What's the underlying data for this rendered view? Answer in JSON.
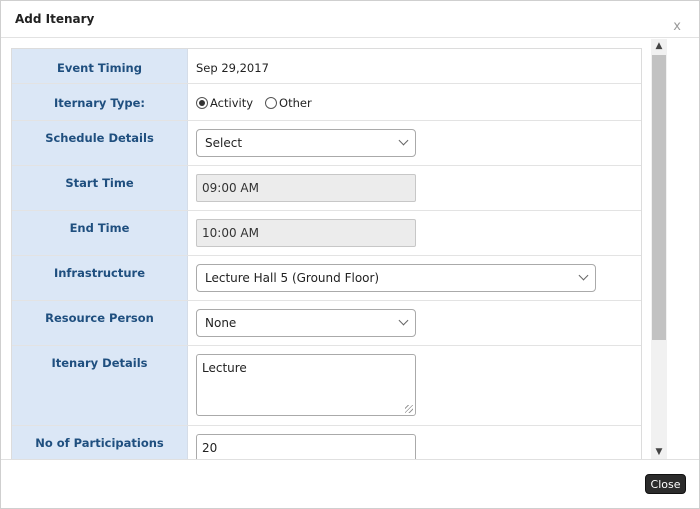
{
  "modal": {
    "title": "Add Itenary",
    "close_glyph": "x",
    "close_button": "Close"
  },
  "form": {
    "event_timing": {
      "label": "Event Timing",
      "value": "Sep 29,2017"
    },
    "itenary_type": {
      "label": "Iternary Type:",
      "options": [
        "Activity",
        "Other"
      ],
      "selected": "Activity"
    },
    "schedule_details": {
      "label": "Schedule Details",
      "value": "Select"
    },
    "start_time": {
      "label": "Start Time",
      "value": "09:00 AM"
    },
    "end_time": {
      "label": "End Time",
      "value": "10:00 AM"
    },
    "infrastructure": {
      "label": "Infrastructure",
      "value": "Lecture Hall 5 (Ground Floor)"
    },
    "resource_person": {
      "label": "Resource Person",
      "value": "None"
    },
    "itenary_details": {
      "label": "Itenary Details",
      "value": "Lecture"
    },
    "participations": {
      "label": "No of Participations",
      "value": "20"
    }
  },
  "scrollbar": {
    "up_glyph": "▲",
    "down_glyph": "▼"
  },
  "colors": {
    "label_bg": "#dbe7f6",
    "label_text": "#1f4f7f",
    "close_button_bg": "#2b2b2b"
  }
}
